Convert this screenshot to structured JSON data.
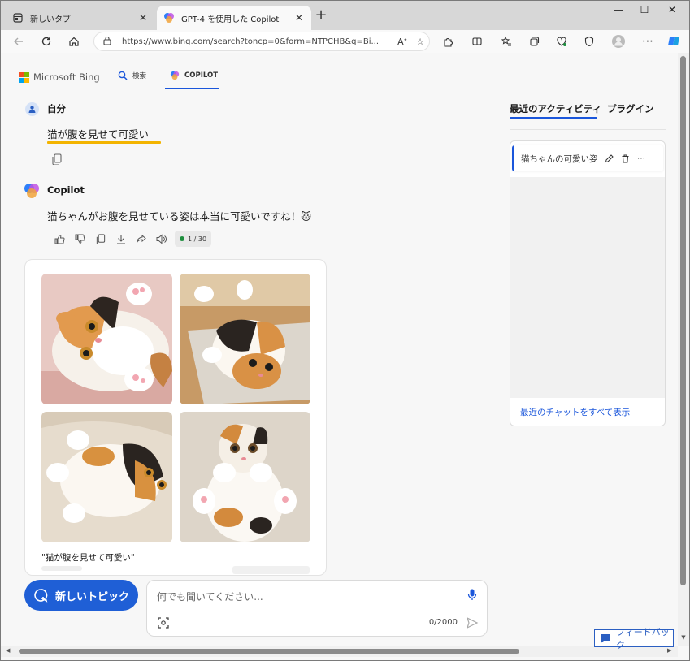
{
  "browser": {
    "tabs": [
      {
        "title": "新しいタブ",
        "icon": "newtab-page-icon"
      },
      {
        "title": "GPT-4 を使用した Copilot",
        "icon": "copilot-icon"
      }
    ],
    "close_glyph": "✕",
    "new_tab_glyph": "+",
    "window_controls": [
      "—",
      "☐",
      "✕"
    ],
    "url": "https://www.bing.com/search?toncp=0&form=NTPCHB&q=Bi...",
    "url_domain": "www.bing.com"
  },
  "header": {
    "logo_text": "Microsoft Bing",
    "nav_search": "検索",
    "nav_copilot": "COPILOT"
  },
  "chat": {
    "user_name": "自分",
    "user_message": "猫が腹を見せて可愛い",
    "bot_name": "Copilot",
    "bot_message": "猫ちゃんがお腹を見せている姿は本当に可愛いですね！🐱",
    "counter": "1 / 30",
    "image_caption": "\"猫が腹を見せて可愛い\""
  },
  "composer": {
    "new_topic_label": "新しいトピック",
    "placeholder": "何でも聞いてください...",
    "char_count": "0/2000"
  },
  "sidebar": {
    "tab_recent": "最近のアクティビティ",
    "tab_plugins": "プラグイン",
    "recent_item": "猫ちゃんの可愛い姿",
    "see_all": "最近のチャットをすべて表示"
  },
  "feedback_label": "フィードバック",
  "colors": {
    "accent": "#1a56db",
    "new_topic": "#1f5fd6",
    "highlight_underline": "#f3b400",
    "counter_dot": "#1e8e3e"
  }
}
